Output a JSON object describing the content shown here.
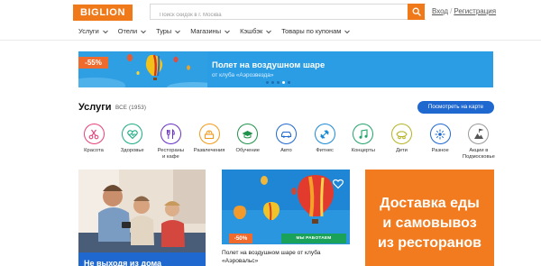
{
  "header": {
    "logo": "BIGLION",
    "search_placeholder": "Поиск скидок в г. Москва",
    "login": "Вход",
    "separator": "/",
    "register": "Регистрация"
  },
  "nav": [
    {
      "label": "Услуги"
    },
    {
      "label": "Отели"
    },
    {
      "label": "Туры"
    },
    {
      "label": "Магазины"
    },
    {
      "label": "Кэшбэк"
    },
    {
      "label": "Товары по купонам"
    }
  ],
  "banner": {
    "discount": "-55%",
    "title": "Полет на воздушном шаре",
    "subtitle": "от клуба «Аэрозвезда»",
    "slides": 5,
    "active_slide": 3
  },
  "services": {
    "title": "Услуги",
    "count_label": "ВСЕ (1953)",
    "map_button": "Посмотреть на карте",
    "categories": [
      {
        "label": "Красота",
        "icon": "beauty-icon",
        "color": "#e7417a"
      },
      {
        "label": "Здоровье",
        "icon": "health-icon",
        "color": "#1cab83"
      },
      {
        "label": "Рестораны\nи кафе",
        "icon": "restaurant-icon",
        "color": "#6a2fc8"
      },
      {
        "label": "Развлечения",
        "icon": "entertainment-icon",
        "color": "#f39b1a"
      },
      {
        "label": "Обучение",
        "icon": "education-icon",
        "color": "#21924b"
      },
      {
        "label": "Авто",
        "icon": "car-icon",
        "color": "#1f68cf"
      },
      {
        "label": "Фитнес",
        "icon": "fitness-icon",
        "color": "#1a8ad6"
      },
      {
        "label": "Концерты",
        "icon": "concert-icon",
        "color": "#22a36a"
      },
      {
        "label": "Дети",
        "icon": "kids-icon",
        "color": "#b6b324"
      },
      {
        "label": "Разное",
        "icon": "misc-icon",
        "color": "#1f68cf"
      },
      {
        "label": "Акции в\nПодмосковье",
        "icon": "promo-icon",
        "color": "#555555"
      }
    ]
  },
  "cards": {
    "card1_text": "Не выходя из дома",
    "card2": {
      "discount": "-50%",
      "tag": "МЫ РАБОТАЕМ",
      "title": "Полет на воздушном шаре от клуба «Аэровальс»"
    },
    "card3_text": "Доставка еды\nи самовывоз\nиз ресторанов"
  },
  "colors": {
    "brand_orange": "#f07a1a",
    "accent_blue": "#1f68cf",
    "banner_blue": "#2a9de4"
  }
}
